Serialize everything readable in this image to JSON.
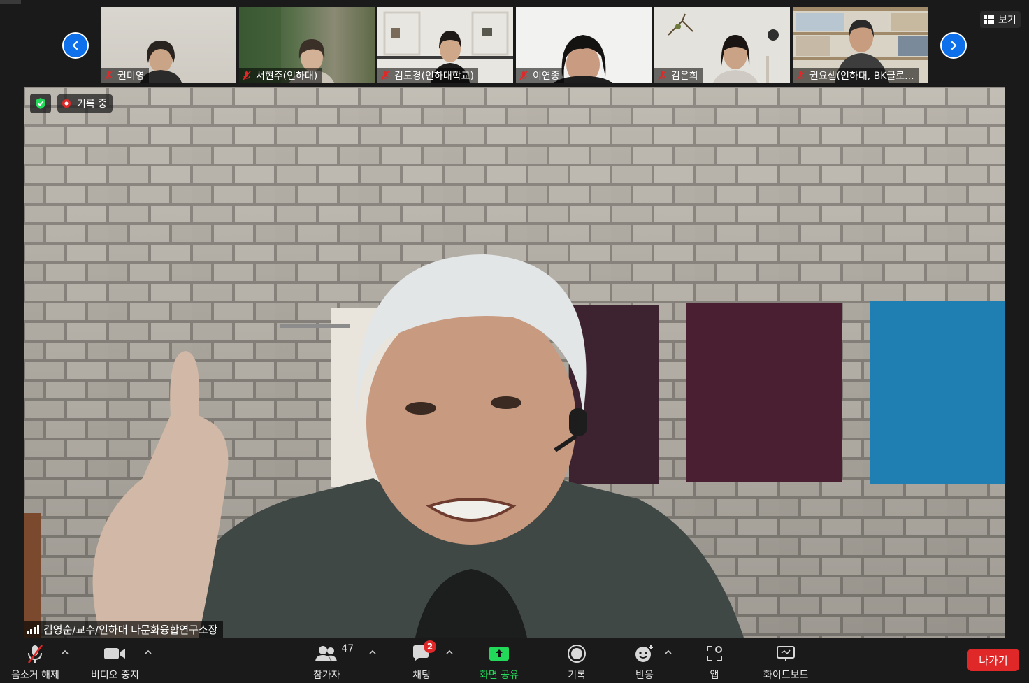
{
  "thumbnail_strip": {
    "participants": [
      {
        "name": "권미영",
        "muted": true
      },
      {
        "name": "서현주(인하대)",
        "muted": true
      },
      {
        "name": "김도경(인하대학교)",
        "muted": true
      },
      {
        "name": "이연종",
        "muted": true
      },
      {
        "name": "김은희",
        "muted": true
      },
      {
        "name": "권요셉(인하대, BK글로...",
        "muted": true
      }
    ],
    "prev_icon": "chevron-left-icon",
    "next_icon": "chevron-right-icon"
  },
  "view_button": {
    "label": "보기",
    "icon": "grid-icon"
  },
  "main_video": {
    "speaker_name": "김영순/교수/인하대 다문화융합연구소장",
    "recording_label": "기록 중",
    "security_icon": "shield-check-icon"
  },
  "toolbar": {
    "unmute_label": "음소거 해제",
    "video_label": "비디오 중지",
    "participants_label": "참가자",
    "participants_count": "47",
    "chat_label": "채팅",
    "chat_badge": "2",
    "share_label": "화면 공유",
    "record_label": "기록",
    "reactions_label": "반응",
    "apps_label": "앱",
    "whiteboard_label": "화이트보드",
    "leave_label": "나가기"
  },
  "colors": {
    "accent_blue": "#0e71eb",
    "share_green": "#23d959",
    "leave_red": "#e02828",
    "muted_red": "#e02828"
  }
}
